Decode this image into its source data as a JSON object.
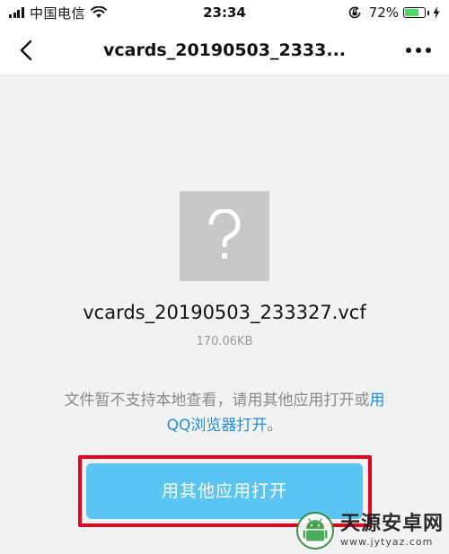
{
  "status_bar": {
    "carrier": "中国电信",
    "time": "23:34",
    "battery_percent": "72%",
    "battery_level": 0.72,
    "icons": [
      "signal-bars-icon",
      "wifi-icon",
      "rotation-lock-icon",
      "battery-icon",
      "charging-icon"
    ]
  },
  "nav": {
    "title": "vcards_20190503_2333...",
    "back_icon": "chevron-left-icon",
    "more_icon": "more-dots-icon"
  },
  "file": {
    "icon": "question-mark-icon",
    "name": "vcards_20190503_233327.vcf",
    "size": "170.06KB"
  },
  "info": {
    "message_prefix": "文件暂不支持本地查看，请用其他应用打开或",
    "link_label": "用QQ浏览器打开",
    "message_suffix": "。"
  },
  "actions": {
    "open_with_label": "用其他应用打开"
  },
  "watermark": {
    "brand": "天源安卓网",
    "url": "www.jytyaz.com"
  },
  "colors": {
    "accent_button": "#5ac4f2",
    "link": "#1e8ee0",
    "highlight_frame": "#e5001f",
    "background": "#f2f2f2"
  }
}
